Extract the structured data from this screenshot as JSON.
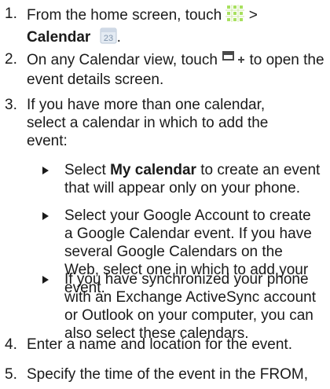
{
  "steps": {
    "s1": {
      "num": "1.",
      "pre": "From the home screen, touch",
      "gt": ">",
      "bold": "Calendar",
      "post": "."
    },
    "s2": {
      "num": "2.",
      "pre": "On any Calendar view, touch",
      "post": "to open the event details screen."
    },
    "s3": {
      "num": "3.",
      "text": "If you have more than one calendar, select a calendar in which to add the event:"
    },
    "s4": {
      "num": "4.",
      "text": "Enter a name and location for the event."
    },
    "s5": {
      "num": "5.",
      "text": "Specify the time of the event in the FROM,"
    }
  },
  "bullets": {
    "b1": {
      "pre": "Select",
      "bold": "My calendar",
      "post": "to create an event that will appear only on your phone."
    },
    "b2": {
      "text": "Select your Google Account to create a Google Calendar event. If you have several Google Calendars on the Web, select one in which to add your event."
    },
    "b3": {
      "text": "If you have synchronized your phone with an Exchange ActiveSync account or Outlook on your computer, you can also select these calendars."
    }
  },
  "icons": {
    "apps": "all-apps-grid-icon",
    "calendar": "calendar-app-icon",
    "new_event": "new-event-icon",
    "calendar_day": "23"
  },
  "colors": {
    "text": "#1a1a1a",
    "apps_grid": "#a8e05f",
    "calendar_icon": "#cfd9e6"
  }
}
